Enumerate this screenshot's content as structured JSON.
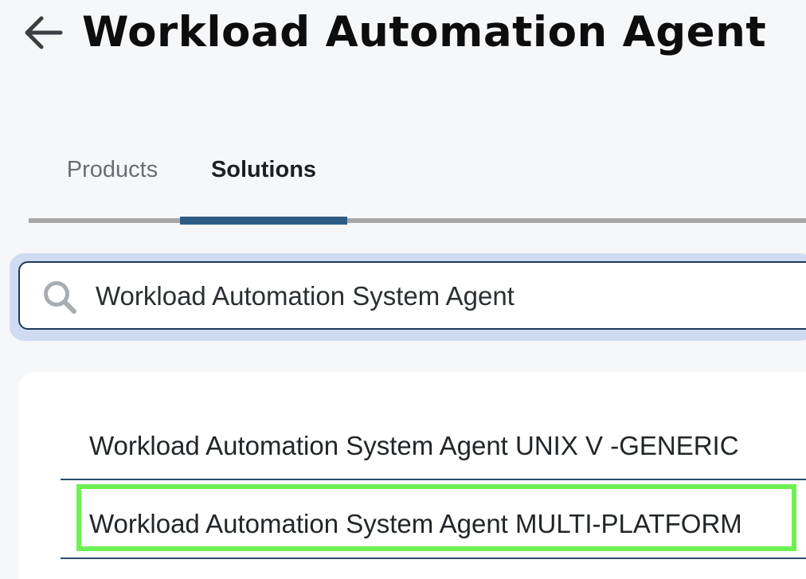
{
  "header": {
    "title": "Workload Automation Agent",
    "back_icon": "arrow-left-icon"
  },
  "tabs": [
    {
      "label": "Products",
      "active": false
    },
    {
      "label": "Solutions",
      "active": true
    }
  ],
  "search": {
    "value": "Workload Automation System Agent",
    "icon": "search-icon"
  },
  "results": [
    {
      "label": "Workload Automation System Agent UNIX V -GENERIC",
      "highlighted": false
    },
    {
      "label": "Workload Automation System Agent MULTI-PLATFORM",
      "highlighted": true
    }
  ],
  "colors": {
    "active_tab_indicator": "#2d5d85",
    "highlight": "#6ef052",
    "search_focus_ring": "#cfdbf3"
  }
}
